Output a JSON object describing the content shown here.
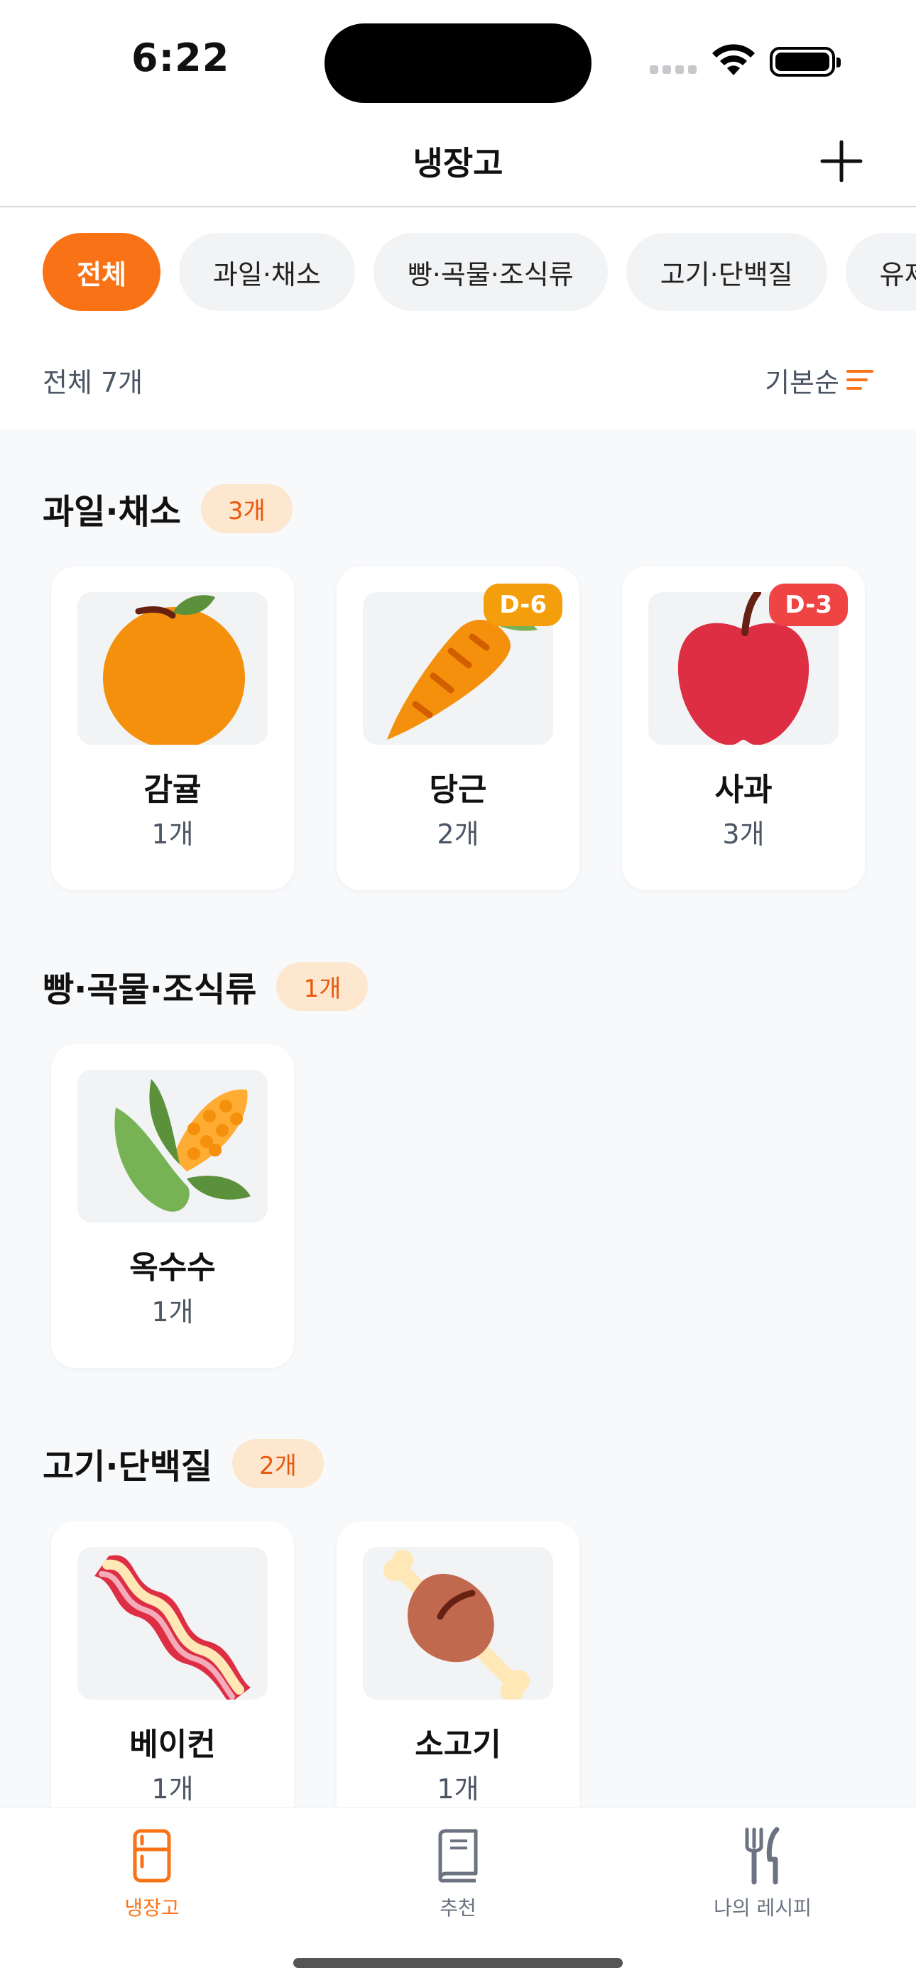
{
  "status_bar": {
    "time": "6:22"
  },
  "nav": {
    "title": "냉장고"
  },
  "filters": [
    {
      "label": "전체",
      "active": true
    },
    {
      "label": "과일·채소",
      "active": false
    },
    {
      "label": "빵·곡물·조식류",
      "active": false
    },
    {
      "label": "고기·단백질",
      "active": false
    },
    {
      "label": "유제",
      "active": false
    }
  ],
  "summary": {
    "count": "전체 7개",
    "sort": "기본순"
  },
  "sections": [
    {
      "title": "과일·채소",
      "count": "3개",
      "items": [
        {
          "name": "감귤",
          "qty": "1개",
          "icon": "tangerine-icon",
          "dday": ""
        },
        {
          "name": "당근",
          "qty": "2개",
          "icon": "carrot-icon",
          "dday": "D-6"
        },
        {
          "name": "사과",
          "qty": "3개",
          "icon": "apple-icon",
          "dday": "D-3"
        }
      ]
    },
    {
      "title": "빵·곡물·조식류",
      "count": "1개",
      "items": [
        {
          "name": "옥수수",
          "qty": "1개",
          "icon": "corn-icon",
          "dday": ""
        }
      ]
    },
    {
      "title": "고기·단백질",
      "count": "2개",
      "items": [
        {
          "name": "베이컨",
          "qty": "1개",
          "icon": "bacon-icon",
          "dday": ""
        },
        {
          "name": "소고기",
          "qty": "1개",
          "icon": "meat-on-bone-icon",
          "dday": ""
        }
      ]
    }
  ],
  "tabs": [
    {
      "label": "냉장고",
      "icon": "fridge-icon",
      "active": true
    },
    {
      "label": "추천",
      "icon": "book-icon",
      "active": false
    },
    {
      "label": "나의 레시피",
      "icon": "fork-knife-icon",
      "active": false
    }
  ],
  "colors": {
    "accent": "#f97316",
    "dday_warning": "#f59e0b",
    "dday_danger": "#ef4444"
  }
}
